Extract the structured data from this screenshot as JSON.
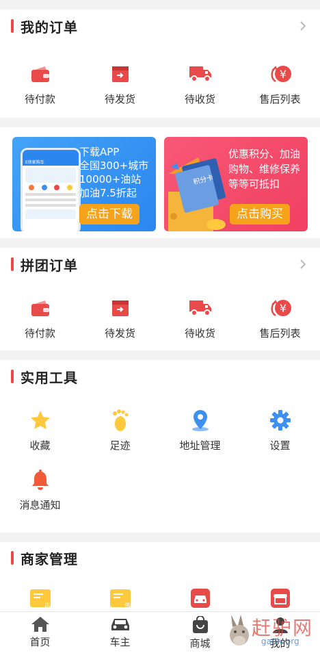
{
  "orders": {
    "title": "我的订单",
    "items": [
      {
        "label": "待付款",
        "icon": "wallet-icon"
      },
      {
        "label": "待发货",
        "icon": "ship-box-icon"
      },
      {
        "label": "待收货",
        "icon": "truck-icon"
      },
      {
        "label": "售后列表",
        "icon": "refund-yen-icon"
      }
    ]
  },
  "banners": {
    "left": {
      "lines": [
        "下载APP",
        "全国300+城市",
        "10000+油站",
        "加油7.5折起"
      ],
      "phone_title": "E房家购车",
      "button": "点击下载"
    },
    "right": {
      "lines": [
        "优惠积分、加油",
        "购物、维修保养",
        "等等可抵扣"
      ],
      "card_text": "积分卡",
      "button": "点击购买"
    }
  },
  "group_orders": {
    "title": "拼团订单",
    "items": [
      {
        "label": "待付款",
        "icon": "wallet-icon"
      },
      {
        "label": "待发货",
        "icon": "ship-box-icon"
      },
      {
        "label": "待收货",
        "icon": "truck-icon"
      },
      {
        "label": "售后列表",
        "icon": "refund-yen-icon"
      }
    ]
  },
  "tools": {
    "title": "实用工具",
    "items": [
      {
        "label": "收藏",
        "icon": "star-icon"
      },
      {
        "label": "足迹",
        "icon": "footprint-icon"
      },
      {
        "label": "地址管理",
        "icon": "location-pin-icon"
      },
      {
        "label": "设置",
        "icon": "gear-icon"
      },
      {
        "label": "消息通知",
        "icon": "bell-icon"
      }
    ]
  },
  "merchant": {
    "title": "商家管理",
    "badges": [
      "店",
      "供"
    ]
  },
  "tabbar": [
    {
      "label": "首页",
      "icon": "home-icon"
    },
    {
      "label": "车主",
      "icon": "car-icon"
    },
    {
      "label": "商城",
      "icon": "shopping-bag-icon"
    },
    {
      "label": "我的",
      "icon": "user-icon"
    }
  ],
  "watermark": {
    "text": "赶驴网",
    "sub": "ganlv.org"
  },
  "colors": {
    "accent": "#e84a4a",
    "orange": "#f7a21b",
    "blue": "#3d8ff0",
    "yellow": "#ffc83d"
  }
}
